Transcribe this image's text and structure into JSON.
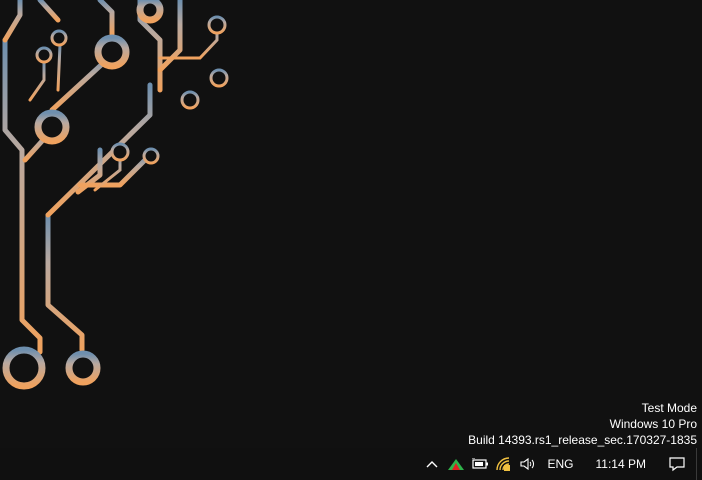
{
  "watermark": {
    "line1": "Test Mode",
    "line2": "Windows 10 Pro",
    "line3": "Build 14393.rs1_release_sec.170327-1835"
  },
  "taskbar": {
    "tray": {
      "icons": [
        "chevron-up-icon",
        "app-tray-icon",
        "battery-icon",
        "wifi-icon",
        "speaker-icon",
        "action-center-icon"
      ],
      "language": "ENG",
      "time": "11:14 PM"
    }
  },
  "colors": {
    "background": "#111111",
    "circuit_top": "#6e8fae",
    "circuit_bottom": "#f0a25e"
  }
}
